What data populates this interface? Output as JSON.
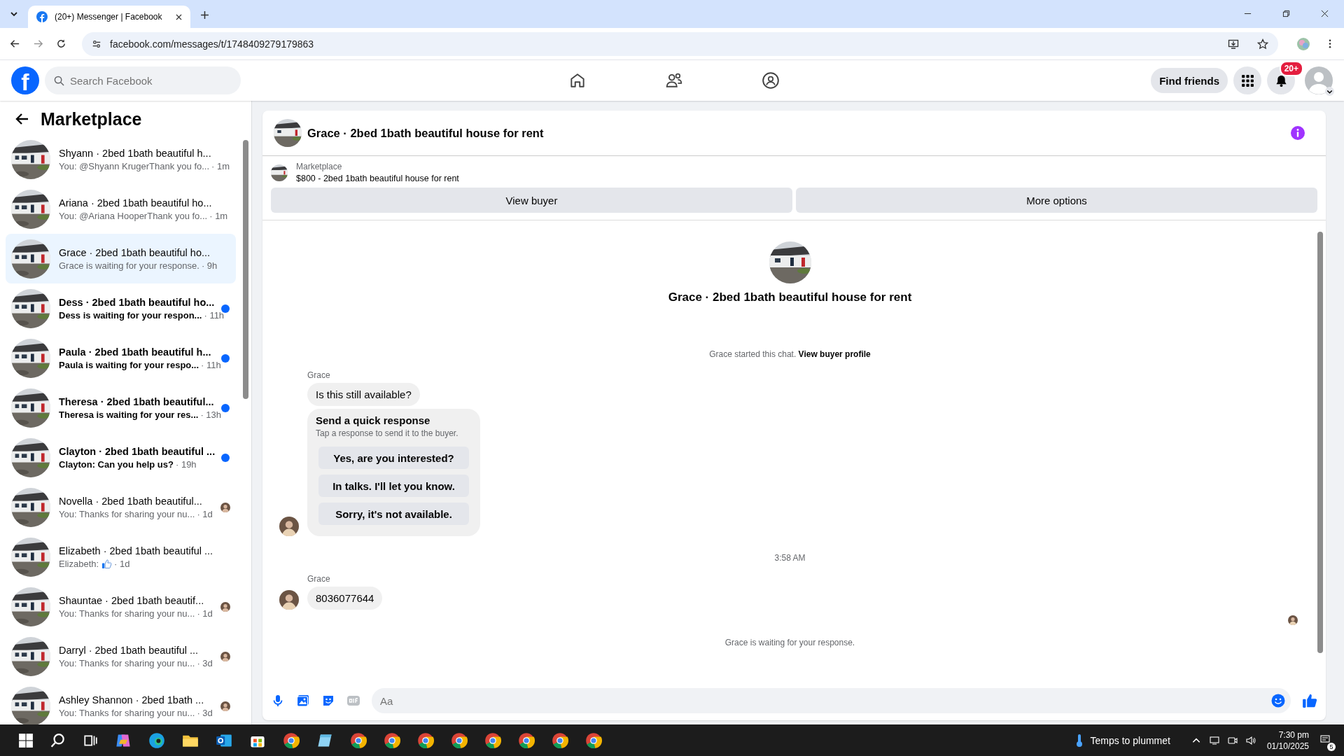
{
  "browser": {
    "tab_title": "(20+) Messenger | Facebook",
    "url": "facebook.com/messages/t/1748409279179863"
  },
  "header": {
    "logo": "f",
    "search_placeholder": "Search Facebook",
    "find_friends": "Find friends",
    "notification_badge": "20+"
  },
  "sidebar": {
    "title": "Marketplace",
    "conversations": [
      {
        "title": "Shyann · 2bed 1bath beautiful h...",
        "preview": "You: @Shyann KrugerThank you fo...",
        "time": "· 1m",
        "unread": false,
        "selected": false,
        "seen": false,
        "like_sticker": false
      },
      {
        "title": "Ariana · 2bed 1bath beautiful ho...",
        "preview": "You: @Ariana HooperThank you fo...",
        "time": "· 1m",
        "unread": false,
        "selected": false,
        "seen": false,
        "like_sticker": false
      },
      {
        "title": "Grace · 2bed 1bath beautiful ho...",
        "preview": "Grace is waiting for your response.",
        "time": "· 9h",
        "unread": false,
        "selected": true,
        "seen": false,
        "like_sticker": false
      },
      {
        "title": "Dess · 2bed 1bath beautiful ho...",
        "preview": "Dess is waiting for your respon...",
        "time": "· 11h",
        "unread": true,
        "selected": false,
        "seen": false,
        "like_sticker": false
      },
      {
        "title": "Paula · 2bed 1bath beautiful h...",
        "preview": "Paula is waiting for your respo...",
        "time": "· 11h",
        "unread": true,
        "selected": false,
        "seen": false,
        "like_sticker": false
      },
      {
        "title": "Theresa · 2bed 1bath beautiful...",
        "preview": "Theresa is waiting for your res...",
        "time": "· 13h",
        "unread": true,
        "selected": false,
        "seen": false,
        "like_sticker": false
      },
      {
        "title": "Clayton · 2bed 1bath beautiful ...",
        "preview": "Clayton: Can you help us?",
        "time": "· 19h",
        "unread": true,
        "selected": false,
        "seen": false,
        "like_sticker": false
      },
      {
        "title": "Novella · 2bed 1bath beautiful...",
        "preview": "You: Thanks for sharing your nu...",
        "time": "· 1d",
        "unread": false,
        "selected": false,
        "seen": true,
        "like_sticker": false
      },
      {
        "title": "Elizabeth · 2bed 1bath beautiful ...",
        "preview": "Elizabeth:",
        "time": "· 1d",
        "unread": false,
        "selected": false,
        "seen": false,
        "like_sticker": true
      },
      {
        "title": "Shauntae · 2bed 1bath beautif...",
        "preview": "You: Thanks for sharing your nu...",
        "time": "· 1d",
        "unread": false,
        "selected": false,
        "seen": true,
        "like_sticker": false
      },
      {
        "title": "Darryl · 2bed 1bath beautiful ...",
        "preview": "You: Thanks for sharing your nu...",
        "time": "· 3d",
        "unread": false,
        "selected": false,
        "seen": true,
        "like_sticker": false
      },
      {
        "title": "Ashley Shannon · 2bed 1bath ...",
        "preview": "You: Thanks for sharing your nu...",
        "time": "· 3d",
        "unread": false,
        "selected": false,
        "seen": true,
        "like_sticker": false
      }
    ]
  },
  "chat": {
    "title": "Grace · 2bed 1bath beautiful house for rent",
    "listing": {
      "label": "Marketplace",
      "text": "$800 - 2bed 1bath beautiful house for rent"
    },
    "actions": [
      "View buyer",
      "More options"
    ],
    "intro": {
      "title": "Grace · 2bed 1bath beautiful house for rent",
      "started": "Grace started this chat.",
      "link": "View buyer profile"
    },
    "messages": [
      {
        "kind": "text",
        "sender": "Grace",
        "text": "Is this still available?",
        "avatar": false
      },
      {
        "kind": "quick_response",
        "title": "Send a quick response",
        "subtitle": "Tap a response to send it to the buyer.",
        "options": [
          "Yes, are you interested?",
          "In talks. I'll let you know.",
          "Sorry, it's not available."
        ],
        "avatar": true
      },
      {
        "kind": "timestamp",
        "text": "3:58 AM"
      },
      {
        "kind": "text",
        "sender": "Grace",
        "text": "8036077644",
        "avatar": true
      }
    ],
    "seen": true,
    "status": "Grace is waiting for your response.",
    "composer_placeholder": "Aa"
  },
  "taskbar": {
    "weather": "Temps to plummet",
    "time": "7:30 pm",
    "date": "01/10/2025",
    "notification_count": "5"
  }
}
